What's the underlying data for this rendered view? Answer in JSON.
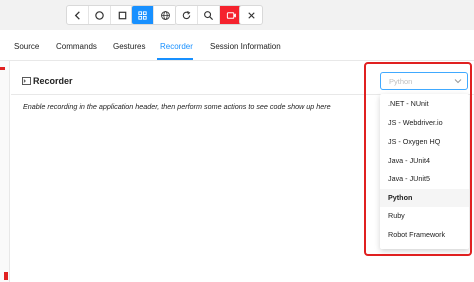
{
  "toolbar": {
    "buttons": [
      "back-icon",
      "home-icon",
      "app-switch-icon",
      "select-elements-icon",
      "globe-icon",
      "refresh-icon",
      "search-icon",
      "record-icon",
      "close-icon"
    ]
  },
  "tabs": [
    {
      "label": "Source"
    },
    {
      "label": "Commands"
    },
    {
      "label": "Gestures"
    },
    {
      "label": "Recorder"
    },
    {
      "label": "Session Information"
    }
  ],
  "recorder": {
    "title": "Recorder",
    "hint": "Enable recording in the application header, then perform some actions to see code show up here",
    "language_select": {
      "value": "Python",
      "options": [
        ".NET - NUnit",
        "JS - Webdriver.io",
        "JS - Oxygen HQ",
        "Java - JUnit4",
        "Java - JUnit5",
        "Python",
        "Ruby",
        "Robot Framework"
      ],
      "selected_index": 5
    }
  },
  "colors": {
    "accent": "#1890ff",
    "highlight": "#e02020",
    "record": "#f5222d"
  }
}
